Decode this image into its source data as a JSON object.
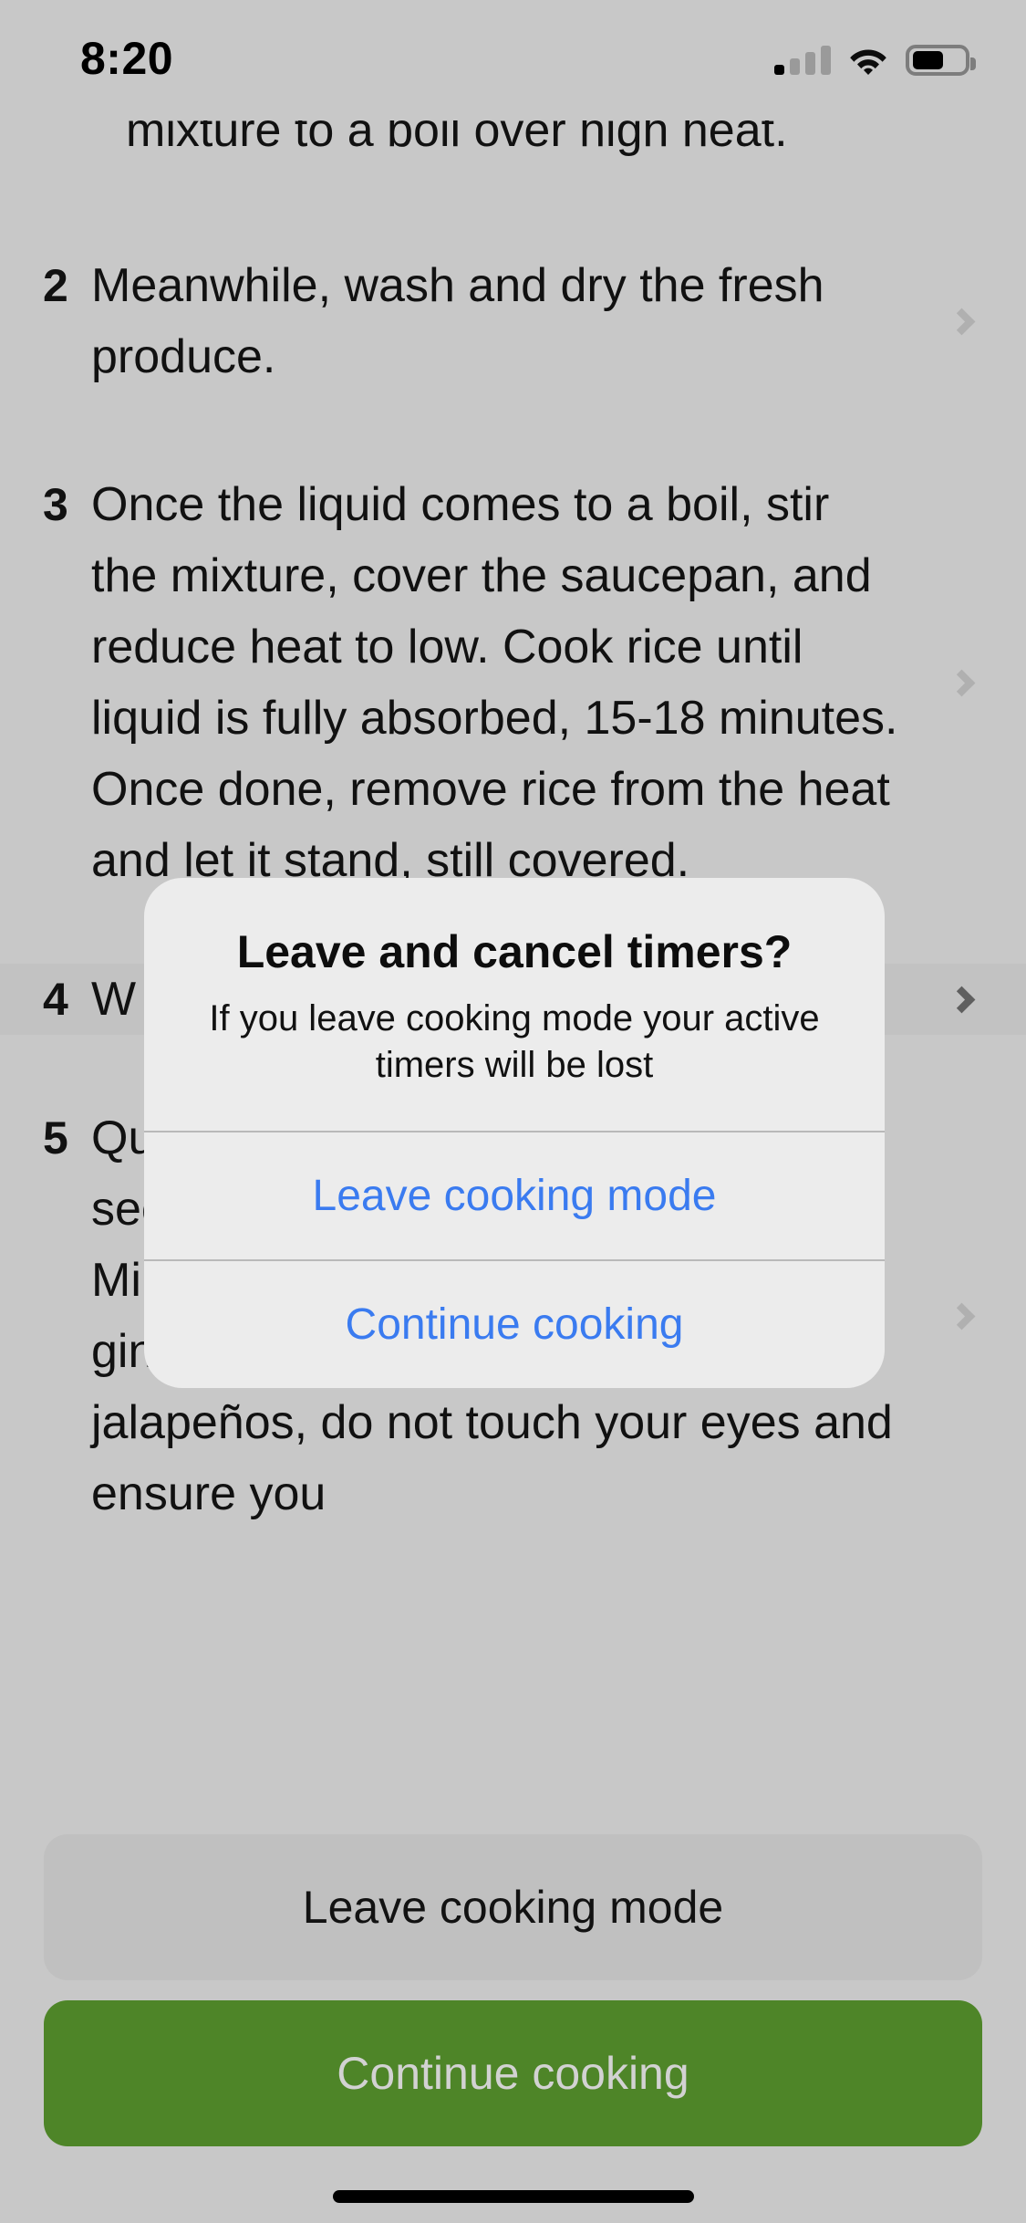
{
  "status_bar": {
    "time": "8:20",
    "signal_icon": "cellular-signal-icon",
    "wifi_icon": "wifi-icon",
    "battery_icon": "battery-icon",
    "battery_level_percent": 55,
    "signal_bars_filled": 1,
    "signal_bars_total": 4
  },
  "recipe_steps": {
    "partial_top_step": {
      "text_fragment": "mixture to a boil over high heat."
    },
    "items": [
      {
        "number": "2",
        "text": "Meanwhile, wash and dry the fresh produce.",
        "highlighted": false,
        "chevron_icon": "chevron-right-icon"
      },
      {
        "number": "3",
        "text": "Once the liquid comes to a boil, stir the mixture, cover the saucepan, and reduce heat to low. Cook rice until liquid is fully absorbed, 15-18 minutes. Once done, remove rice from the heat and let it stand, still covered.",
        "highlighted": false,
        "chevron_icon": "chevron-right-icon"
      },
      {
        "number": "4",
        "text": "W                                              d m                                             a s",
        "highlighted": true,
        "chevron_icon": "chevron-right-icon"
      },
      {
        "number": "5",
        "text": "Quarter jalapeño pepper lengthwise; seed and remove ribs with a spoon. Mince and add to the bowl with the ginger and garlic. (Be careful, with jalapeños, do not touch your eyes and ensure you",
        "highlighted": false,
        "chevron_icon": "chevron-right-icon"
      }
    ]
  },
  "footer": {
    "leave_button_label": "Leave cooking mode",
    "continue_button_label": "Continue cooking",
    "continue_button_color": "#4e8528",
    "leave_button_color": "#c0c0c0",
    "home_indicator": "home-indicator"
  },
  "alert": {
    "title": "Leave and cancel timers?",
    "message": "If you leave cooking mode your active timers will be lost",
    "leave_label": "Leave cooking mode",
    "continue_label": "Continue cooking",
    "action_color": "#3a7bf0"
  }
}
